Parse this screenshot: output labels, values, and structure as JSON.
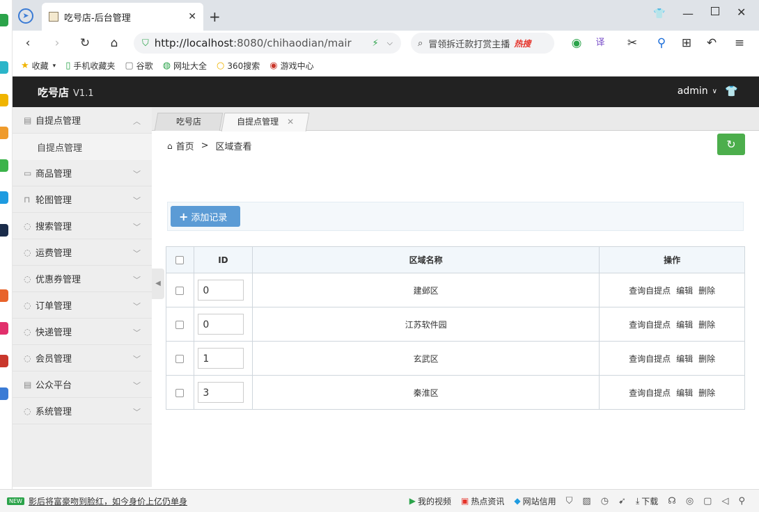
{
  "browser": {
    "tab_title": "吃号店-后台管理",
    "address_host": "http://localhost",
    "address_rest": ":8080/chihaodian/mair",
    "search_text": "冒领拆迁款打赏主播",
    "search_hot": "热搜",
    "bookmarks": [
      "收藏",
      "手机收藏夹",
      "谷歌",
      "网址大全",
      "360搜索",
      "游戏中心"
    ]
  },
  "app": {
    "title": "吃号店",
    "version": "V1.1",
    "user": "admin"
  },
  "sidebar": {
    "items": [
      {
        "label": "自提点管理",
        "expanded": true,
        "sub": [
          "自提点管理"
        ]
      },
      {
        "label": "商品管理"
      },
      {
        "label": "轮图管理"
      },
      {
        "label": "搜索管理"
      },
      {
        "label": "运费管理"
      },
      {
        "label": "优惠券管理"
      },
      {
        "label": "订单管理"
      },
      {
        "label": "快递管理"
      },
      {
        "label": "会员管理"
      },
      {
        "label": "公众平台"
      },
      {
        "label": "系统管理"
      }
    ]
  },
  "main": {
    "tabs": [
      {
        "label": "吃号店"
      },
      {
        "label": "自提点管理"
      }
    ],
    "breadcrumb": {
      "home": "首页",
      "sep": ">",
      "current": "区域查看"
    },
    "add_button": "添加记录",
    "table": {
      "headers": {
        "id": "ID",
        "name": "区域名称",
        "actions": "操作"
      },
      "rows": [
        {
          "id": "0",
          "name": "建邺区"
        },
        {
          "id": "0",
          "name": "江苏软件园"
        },
        {
          "id": "1",
          "name": "玄武区"
        },
        {
          "id": "3",
          "name": "秦淮区"
        }
      ],
      "actions": {
        "view": "查询自提点",
        "edit": "编辑",
        "delete": "删除"
      }
    }
  },
  "statusbar": {
    "news_badge": "NEW",
    "news": "影后将富豪吻到脸红，如今身价上亿仍单身",
    "items": [
      "我的视频",
      "热点资讯",
      "网站信用",
      "下载"
    ]
  },
  "colors": {
    "header_bg": "#222222",
    "add_button": "#5b9bd5",
    "refresh_button": "#4cae4c"
  }
}
